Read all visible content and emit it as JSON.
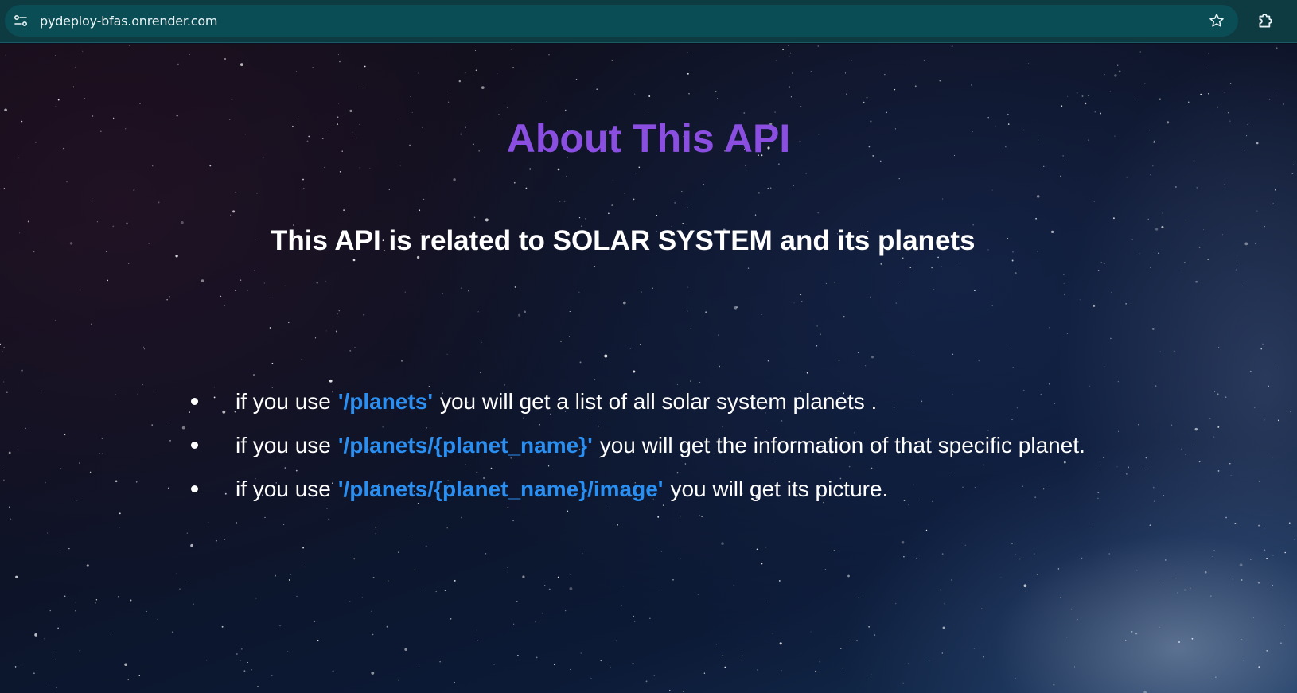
{
  "browser": {
    "url": "pydeploy-bfas.onrender.com",
    "icons": {
      "site_info": "site-info-tune-icon",
      "bookmark": "star-icon",
      "extensions": "puzzle-extensions-icon"
    }
  },
  "page": {
    "title": "About This API",
    "subtitle": "This API is related to SOLAR SYSTEM and its planets",
    "endpoints": [
      {
        "prefix": "if you use",
        "path": "'/planets'",
        "suffix": "you will get a list of all solar system planets ."
      },
      {
        "prefix": "if you use",
        "path": "'/planets/{planet_name}'",
        "suffix": "you will get the information of that specific planet."
      },
      {
        "prefix": "if you use",
        "path": "'/planets/{planet_name}/image'",
        "suffix": "you will get its picture."
      }
    ],
    "colors": {
      "title": "#8a4fe0",
      "path": "#2a8ff0",
      "text": "#ffffff",
      "toolbar": "#0e3a42"
    }
  }
}
